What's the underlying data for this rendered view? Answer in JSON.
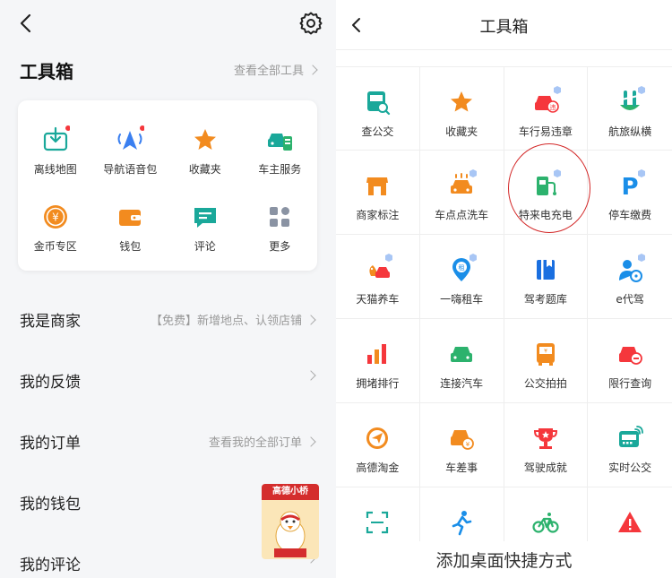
{
  "left": {
    "toolbox": {
      "title": "工具箱",
      "view_all": "查看全部工具"
    },
    "tools": [
      {
        "label": "离线地图",
        "icon": "offline-map-icon"
      },
      {
        "label": "导航语音包",
        "icon": "nav-voice-icon"
      },
      {
        "label": "收藏夹",
        "icon": "star-icon"
      },
      {
        "label": "车主服务",
        "icon": "car-service-icon"
      },
      {
        "label": "金币专区",
        "icon": "coin-icon"
      },
      {
        "label": "钱包",
        "icon": "wallet-icon"
      },
      {
        "label": "评论",
        "icon": "comment-icon"
      },
      {
        "label": "更多",
        "icon": "more-icon"
      }
    ],
    "menu": [
      {
        "title": "我是商家",
        "right": "【免费】新增地点、认领店铺"
      },
      {
        "title": "我的反馈",
        "right": ""
      },
      {
        "title": "我的订单",
        "right": "查看我的全部订单"
      },
      {
        "title": "我的钱包",
        "right": ""
      },
      {
        "title": "我的评论",
        "right": ""
      }
    ],
    "promo_title": "高德小桥"
  },
  "right": {
    "title": "工具箱",
    "rows": [
      [
        {
          "label": "查公交",
          "icon": "bus-search-icon"
        },
        {
          "label": "收藏夹",
          "icon": "star-icon"
        },
        {
          "label": "车行易违章",
          "icon": "violation-icon"
        },
        {
          "label": "航旅纵横",
          "icon": "flight-icon"
        }
      ],
      [
        {
          "label": "商家标注",
          "icon": "shop-icon"
        },
        {
          "label": "车点点洗车",
          "icon": "car-wash-icon"
        },
        {
          "label": "特来电充电",
          "icon": "charging-icon"
        },
        {
          "label": "停车缴费",
          "icon": "parking-icon"
        }
      ],
      [
        {
          "label": "天猫养车",
          "icon": "tmall-car-icon"
        },
        {
          "label": "一嗨租车",
          "icon": "car-rent-icon"
        },
        {
          "label": "驾考题库",
          "icon": "driving-exam-icon"
        },
        {
          "label": "e代驾",
          "icon": "driver-icon"
        }
      ],
      [
        {
          "label": "拥堵排行",
          "icon": "congestion-icon"
        },
        {
          "label": "连接汽车",
          "icon": "connect-car-icon"
        },
        {
          "label": "公交拍拍",
          "icon": "bus-photo-icon"
        },
        {
          "label": "限行查询",
          "icon": "restriction-icon"
        }
      ],
      [
        {
          "label": "高德淘金",
          "icon": "gold-icon"
        },
        {
          "label": "车差事",
          "icon": "car-errand-icon"
        },
        {
          "label": "驾驶成就",
          "icon": "trophy-icon"
        },
        {
          "label": "实时公交",
          "icon": "realtime-bus-icon"
        }
      ],
      [
        {
          "label": "",
          "icon": "scan-icon"
        },
        {
          "label": "",
          "icon": "run-icon"
        },
        {
          "label": "",
          "icon": "bike-icon"
        },
        {
          "label": "",
          "icon": "warning-car-icon"
        }
      ]
    ],
    "bottom_action": "添加桌面快捷方式"
  },
  "colors": {
    "teal": "#1aa89a",
    "blue": "#3a7ff0",
    "orange": "#f28b1f",
    "red": "#f5373c",
    "green": "#2cb26d"
  }
}
